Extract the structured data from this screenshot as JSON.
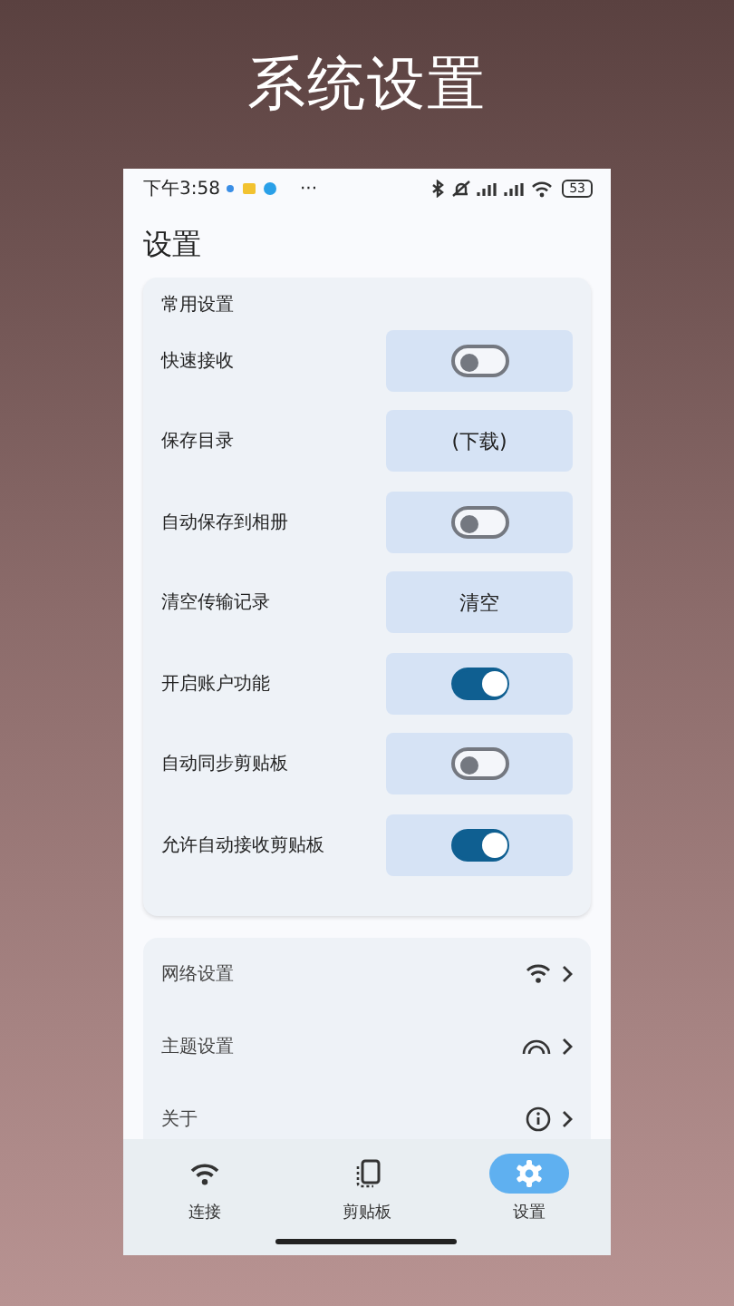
{
  "title": "系统设置",
  "status_bar": {
    "time": "下午3:58",
    "more": "···",
    "battery": "53"
  },
  "header": "设置",
  "common": {
    "title": "常用设置",
    "rows": [
      {
        "label": "快速接收",
        "kind": "switch",
        "on": false
      },
      {
        "label": "保存目录",
        "kind": "button",
        "value": "(下载)"
      },
      {
        "label": "自动保存到相册",
        "kind": "switch",
        "on": false
      },
      {
        "label": "清空传输记录",
        "kind": "button",
        "value": "清空"
      },
      {
        "label": "开启账户功能",
        "kind": "switch",
        "on": true
      },
      {
        "label": "自动同步剪贴板",
        "kind": "switch",
        "on": false
      },
      {
        "label": "允许自动接收剪贴板",
        "kind": "switch",
        "on": true
      }
    ]
  },
  "links": [
    {
      "label": "网络设置"
    },
    {
      "label": "主题设置"
    },
    {
      "label": "关于"
    }
  ],
  "nav": [
    {
      "label": "连接",
      "selected": false
    },
    {
      "label": "剪贴板",
      "selected": false
    },
    {
      "label": "设置",
      "selected": true
    }
  ]
}
